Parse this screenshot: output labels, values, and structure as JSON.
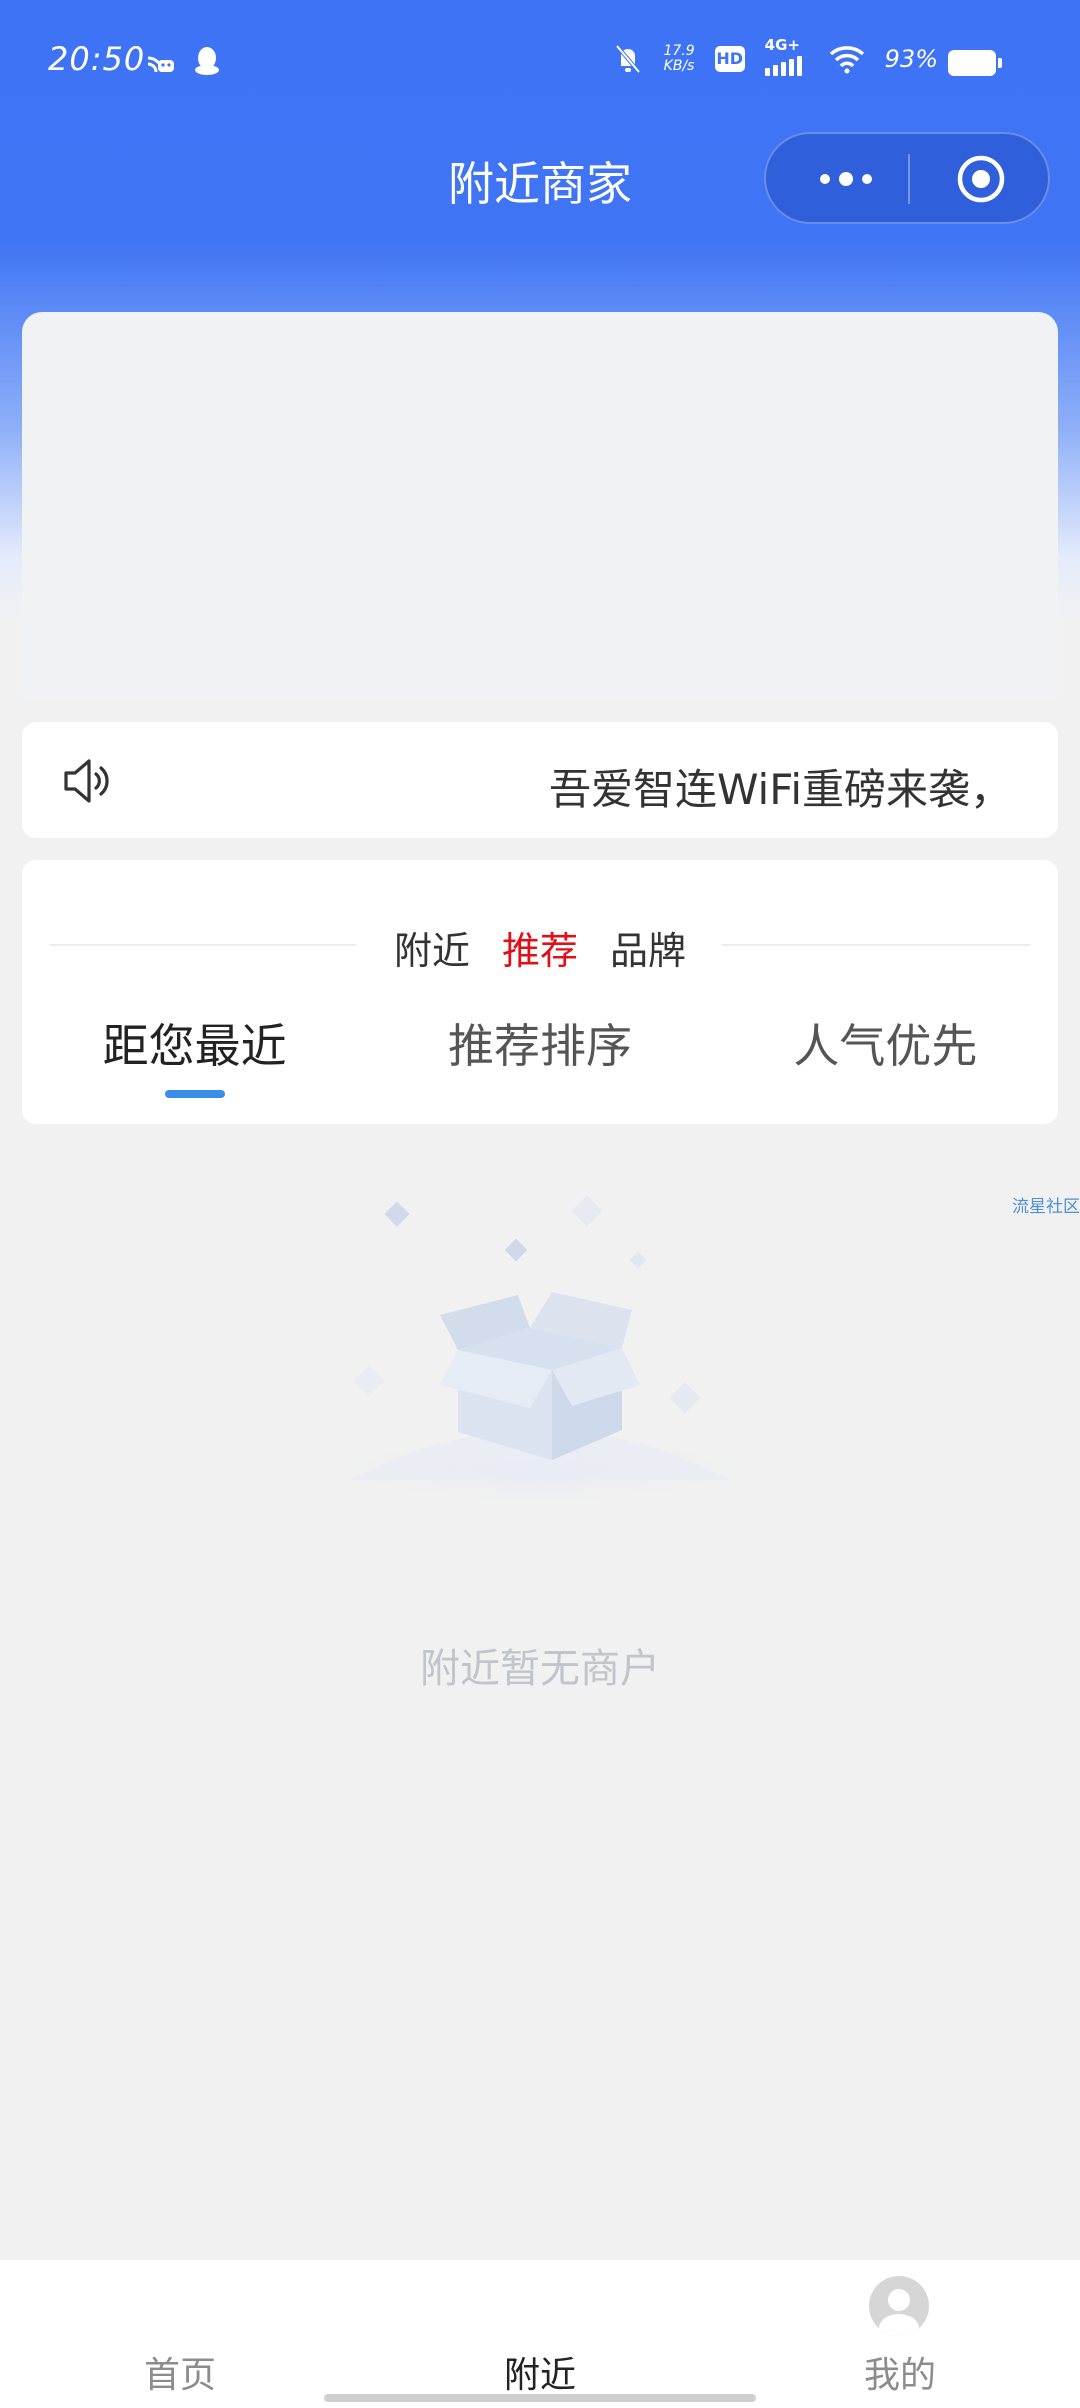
{
  "status_bar": {
    "time": "20:50",
    "net_speed_value": "17.9",
    "net_speed_unit": "KB/s",
    "hd": "HD",
    "network": "4G+",
    "battery": "93%"
  },
  "header": {
    "title": "附近商家"
  },
  "notice": {
    "text": "吾爱智连WiFi重磅来袭，"
  },
  "filter": {
    "subtabs": [
      {
        "label": "附近",
        "active": false
      },
      {
        "label": "推荐",
        "active": true
      },
      {
        "label": "品牌",
        "active": false
      }
    ],
    "sort_tabs": [
      {
        "label": "距您最近",
        "active": true
      },
      {
        "label": "推荐排序",
        "active": false
      },
      {
        "label": "人气优先",
        "active": false
      }
    ]
  },
  "watermark": "流星社区",
  "empty_state": {
    "text": "附近暂无商户"
  },
  "tabbar": {
    "items": [
      {
        "label": "首页",
        "active": false
      },
      {
        "label": "附近",
        "active": true
      },
      {
        "label": "我的",
        "active": false
      }
    ]
  },
  "colors": {
    "header_blue": "#3e73f5",
    "active_red": "#e0101b",
    "indicator_blue": "#3a8ee8"
  },
  "icons": {
    "notice": "speaker-icon",
    "more": "more-dots-icon",
    "close": "target-close-icon",
    "profile": "avatar-icon"
  }
}
